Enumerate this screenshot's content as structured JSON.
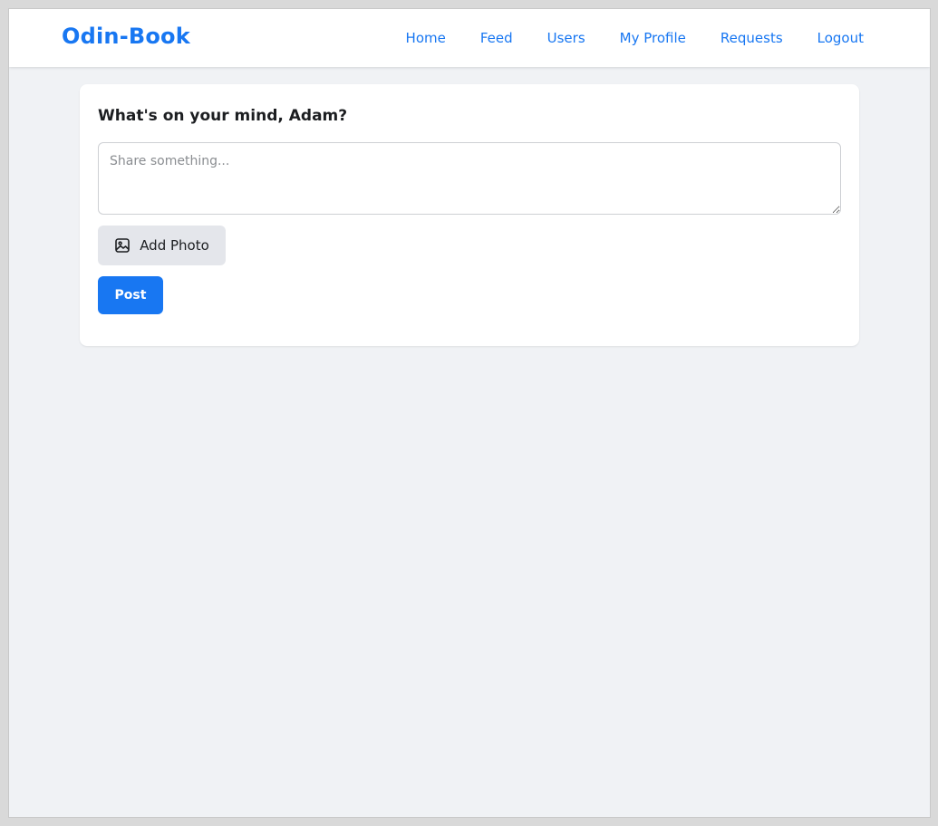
{
  "navbar": {
    "brand": "Odin-Book",
    "links": [
      {
        "label": "Home"
      },
      {
        "label": "Feed"
      },
      {
        "label": "Users"
      },
      {
        "label": "My Profile"
      },
      {
        "label": "Requests"
      },
      {
        "label": "Logout"
      }
    ]
  },
  "composer": {
    "title": "What's on your mind, Adam?",
    "placeholder": "Share something...",
    "value": "",
    "add_photo_label": "Add Photo",
    "add_photo_icon": "image-icon",
    "post_label": "Post"
  },
  "colors": {
    "accent": "#1877f2",
    "page_background": "#f0f2f5",
    "card_background": "#ffffff",
    "secondary_button": "#e4e6eb"
  }
}
